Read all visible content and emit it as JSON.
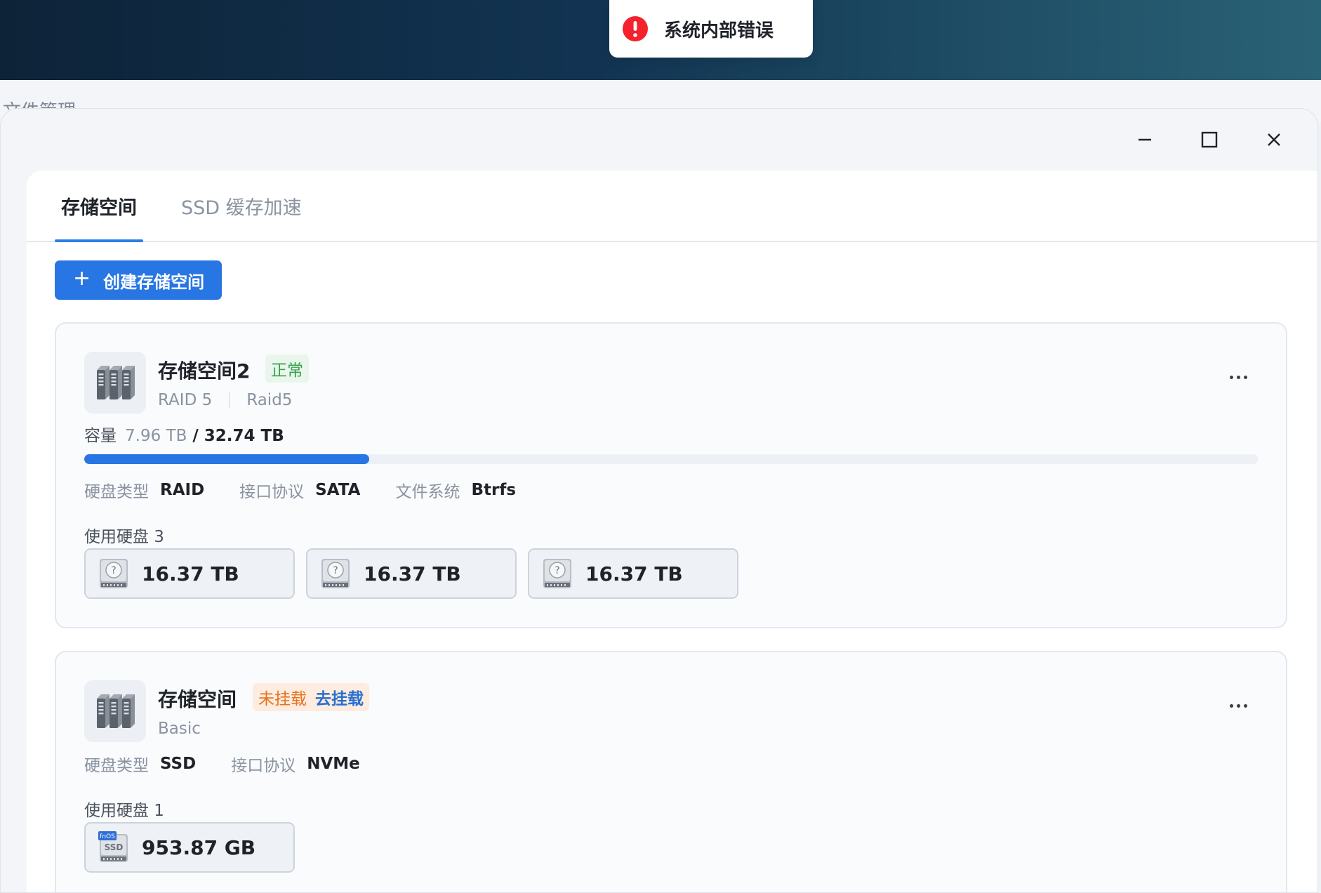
{
  "background_title": "文件管理",
  "toast": {
    "icon": "error-icon",
    "message": "系统内部错误",
    "color": "#f5222d"
  },
  "window_controls": {
    "minimize_icon": "minimize-icon",
    "maximize_icon": "maximize-icon",
    "close_icon": "close-icon"
  },
  "tabs": [
    {
      "label": "存储空间",
      "active": true
    },
    {
      "label": "SSD 缓存加速",
      "active": false
    }
  ],
  "create_button": {
    "icon": "plus",
    "label": "创建存储空间"
  },
  "pools": [
    {
      "name": "存储空间2",
      "status": "正常",
      "raid_level": "RAID 5",
      "raid_name": "Raid5",
      "capacity_label": "容量",
      "used": "7.96 TB",
      "total": "/ 32.74 TB",
      "usage_fraction": 0.2431,
      "meta": [
        {
          "key": "硬盘类型",
          "value": "RAID"
        },
        {
          "key": "接口协议",
          "value": "SATA"
        },
        {
          "key": "文件系统",
          "value": "Btrfs"
        }
      ],
      "disk_count_label": "使用硬盘 3",
      "disks": [
        {
          "icon": "hdd-icon",
          "size": "16.37 TB"
        },
        {
          "icon": "hdd-icon",
          "size": "16.37 TB"
        },
        {
          "icon": "hdd-icon",
          "size": "16.37 TB"
        }
      ]
    },
    {
      "name": "存储空间",
      "status": "未挂载",
      "status_action": "去挂载",
      "raid_name": "Basic",
      "meta": [
        {
          "key": "硬盘类型",
          "value": "SSD"
        },
        {
          "key": "接口协议",
          "value": "NVMe"
        }
      ],
      "disk_count_label": "使用硬盘 1",
      "disks": [
        {
          "icon": "ssd-icon",
          "size": "953.87 GB",
          "label_top": "fnOS",
          "label_main": "SSD"
        }
      ]
    }
  ],
  "colors": {
    "primary": "#2876e3",
    "ok": "#39a24d",
    "warn": "#e8711f"
  }
}
